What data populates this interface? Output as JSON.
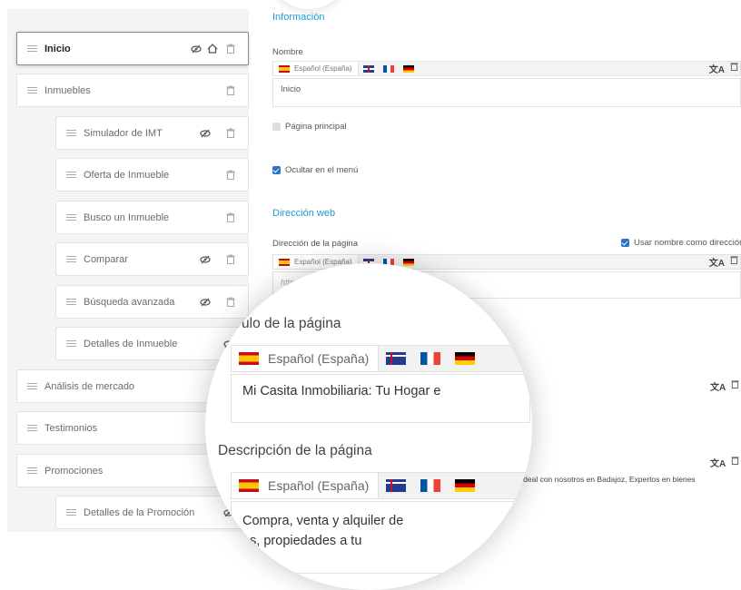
{
  "tree": {
    "items": [
      {
        "label": "Inicio",
        "active": true,
        "hidden": true,
        "home": true
      },
      {
        "label": "Inmuebles"
      },
      {
        "label": "Simulador de IMT",
        "hidden": true
      },
      {
        "label": "Oferta de Inmueble"
      },
      {
        "label": "Busco un Inmueble"
      },
      {
        "label": "Comparar",
        "hidden": true
      },
      {
        "label": "Búsqueda avanzada",
        "hidden": true
      },
      {
        "label": "Detalles de Inmueble",
        "hidden": true
      },
      {
        "label": "Análisis de mercado"
      },
      {
        "label": "Testimonios"
      },
      {
        "label": "Promociones"
      },
      {
        "label": "Detalles de la Promoción",
        "hidden": true
      }
    ]
  },
  "form": {
    "section_info": "Información",
    "name_label": "Nombre",
    "lang_selected": "Español (España)",
    "name_value": "Inicio",
    "main_page_label": "Página principal",
    "main_page_checked": false,
    "hide_menu_label": "Ocultar en el menú",
    "hide_menu_checked": true,
    "section_web": "Dirección web",
    "url_label": "Dirección de la página",
    "use_name_label": "Usar nombre como dirección",
    "url_prefix": "http://www.../",
    "url_value": "inicio",
    "desc_partial": "cuentra tu hogar ideal con nosotros en Badajoz, Expertos en bienes"
  },
  "magnifier": {
    "title_label": "ulo de la página",
    "lang_selected": "Español (España)",
    "title_value": "Mi Casita Inmobiliaria: Tu Hogar e",
    "desc_label": "Descripción de la página",
    "desc_line1": "Compra, venta y alquiler de",
    "desc_line2": "es, propiedades a tu"
  },
  "colors": {
    "accent": "#1e9ad6",
    "checkbox": "#2a73c9"
  }
}
